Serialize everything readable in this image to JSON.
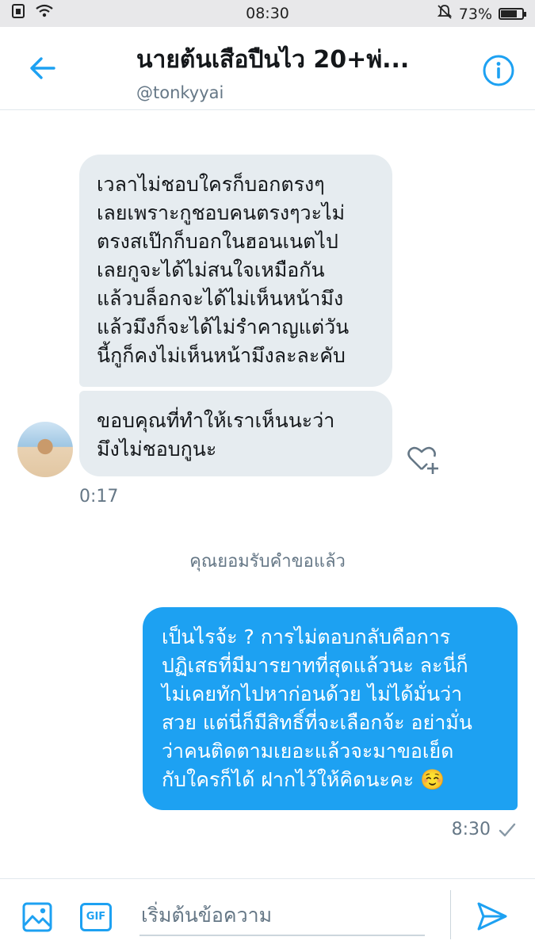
{
  "status_bar": {
    "time": "08:30",
    "battery": "73%",
    "battery_level": 0.73
  },
  "header": {
    "title": "นายต้นเสือปืนไว 20+พ่...",
    "handle": "@tonkyyai"
  },
  "conversation": {
    "incoming": [
      {
        "lines": [
          "เวลาไม่ชอบใครก็บอกตรงๆ",
          "เลยเพราะกูชอบคนตรงๆวะไม่",
          "ตรงสเป๊กก็บอกในฮอนเนตไป",
          "เลยกูจะได้ไม่สนใจเหมือกัน",
          "แล้วบล็อกจะได้ไม่เห็นหน้ามึง",
          "แล้วมึงก็จะได้ไม่รำคาญแต่วัน",
          "นี้กูก็คงไม่เห็นหน้ามึงละละคับ"
        ]
      },
      {
        "lines": [
          "ขอบคุณที่ทำให้เราเห็นนะว่า",
          "มึงไม่ชอบกูนะ"
        ]
      }
    ],
    "incoming_time": "0:17",
    "system_note": "คุณยอมรับคำขอแล้ว",
    "outgoing": {
      "lines": [
        "เป็นไรจ้ะ ? การไม่ตอบกลับคือการ",
        "ปฏิเสธที่มีมารยาทที่สุดแล้วนะ ละนี่ก็",
        "ไม่เคยทักไปหาก่อนด้วย ไม่ได้มั่นว่า",
        "สวย แต่นี่ก็มีสิทธิ์ที่จะเลือกจ้ะ อย่ามั่น",
        "ว่าคนติดตามเยอะแล้วจะมาขอเย็ด",
        "กับใครก็ได้ ฝากไว้ให้คิดนะคะ ☺️"
      ],
      "time": "8:30",
      "status_icon": "check-icon"
    }
  },
  "composer": {
    "placeholder": "เริ่มต้นข้อความ",
    "gif_label": "GIF"
  },
  "colors": {
    "accent": "#1da1f2",
    "incoming_bubble": "#e6ecf0",
    "secondary_text": "#657786"
  }
}
